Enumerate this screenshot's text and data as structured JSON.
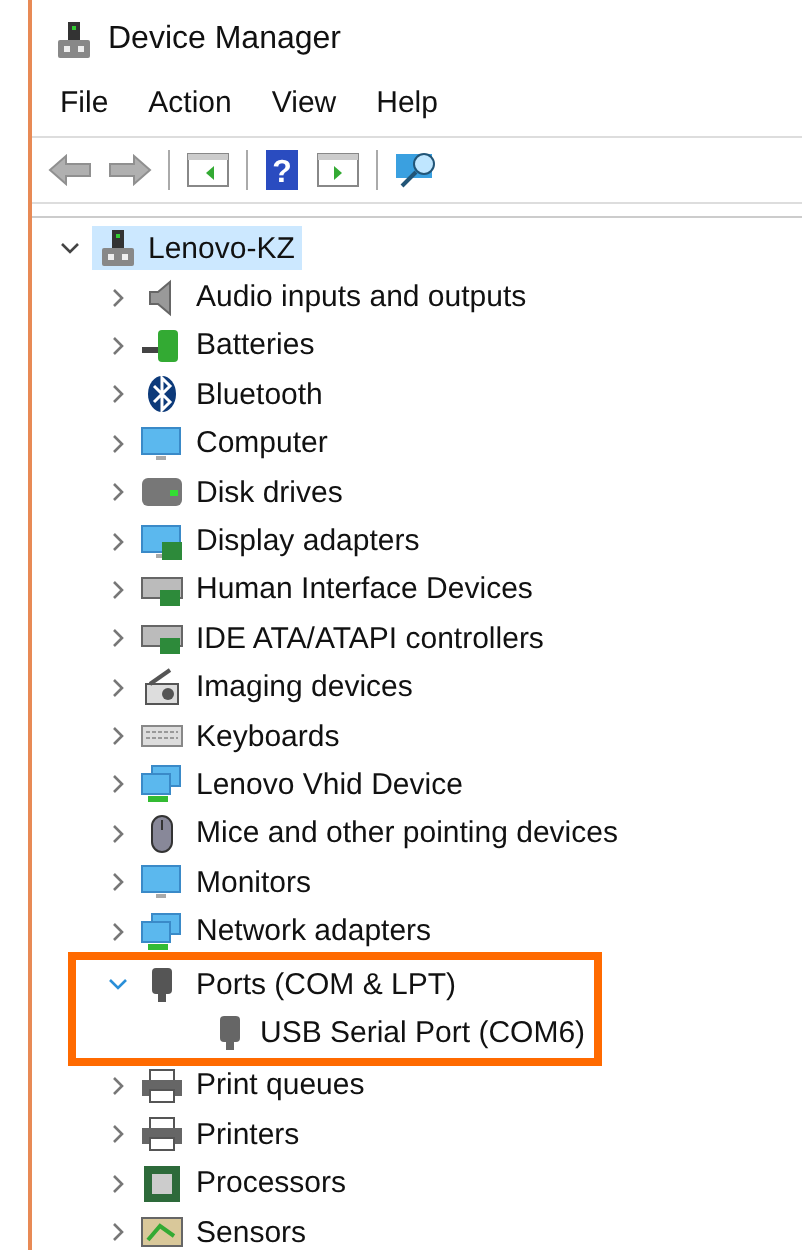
{
  "window": {
    "title": "Device Manager"
  },
  "menu": [
    "File",
    "Action",
    "View",
    "Help"
  ],
  "toolbar": [
    {
      "kind": "back",
      "disabled": true
    },
    {
      "kind": "forward",
      "disabled": true
    },
    {
      "kind": "separator"
    },
    {
      "kind": "console",
      "disabled": false
    },
    {
      "kind": "separator"
    },
    {
      "kind": "help",
      "disabled": false,
      "label": "?"
    },
    {
      "kind": "pane",
      "disabled": false
    },
    {
      "kind": "separator"
    },
    {
      "kind": "scan",
      "disabled": false
    }
  ],
  "tree": {
    "label": "Lenovo-KZ",
    "expanded": true,
    "selected": true,
    "children": [
      {
        "label": "Audio inputs and outputs",
        "expanded": false,
        "selected": false,
        "highlighted": false
      },
      {
        "label": "Batteries",
        "expanded": false,
        "selected": false,
        "highlighted": false
      },
      {
        "label": "Bluetooth",
        "expanded": false,
        "selected": false,
        "highlighted": false
      },
      {
        "label": "Computer",
        "expanded": false,
        "selected": false,
        "highlighted": false
      },
      {
        "label": "Disk drives",
        "expanded": false,
        "selected": false,
        "highlighted": false
      },
      {
        "label": "Display adapters",
        "expanded": false,
        "selected": false,
        "highlighted": false
      },
      {
        "label": "Human Interface Devices",
        "expanded": false,
        "selected": false,
        "highlighted": false
      },
      {
        "label": "IDE ATA/ATAPI controllers",
        "expanded": false,
        "selected": false,
        "highlighted": false
      },
      {
        "label": "Imaging devices",
        "expanded": false,
        "selected": false,
        "highlighted": false
      },
      {
        "label": "Keyboards",
        "expanded": false,
        "selected": false,
        "highlighted": false
      },
      {
        "label": "Lenovo Vhid Device",
        "expanded": false,
        "selected": false,
        "highlighted": false
      },
      {
        "label": "Mice and other pointing devices",
        "expanded": false,
        "selected": false,
        "highlighted": false
      },
      {
        "label": "Monitors",
        "expanded": false,
        "selected": false,
        "highlighted": false
      },
      {
        "label": "Network adapters",
        "expanded": false,
        "selected": false,
        "highlighted": false
      },
      {
        "label": "Ports (COM & LPT)",
        "expanded": true,
        "selected": false,
        "highlighted": true,
        "children": [
          {
            "label": "USB Serial Port (COM6)",
            "selected": false
          }
        ]
      },
      {
        "label": "Print queues",
        "expanded": false,
        "selected": false,
        "highlighted": false
      },
      {
        "label": "Printers",
        "expanded": false,
        "selected": false,
        "highlighted": false
      },
      {
        "label": "Processors",
        "expanded": false,
        "selected": false,
        "highlighted": false
      },
      {
        "label": "Sensors",
        "expanded": false,
        "selected": false,
        "highlighted": false
      }
    ]
  }
}
